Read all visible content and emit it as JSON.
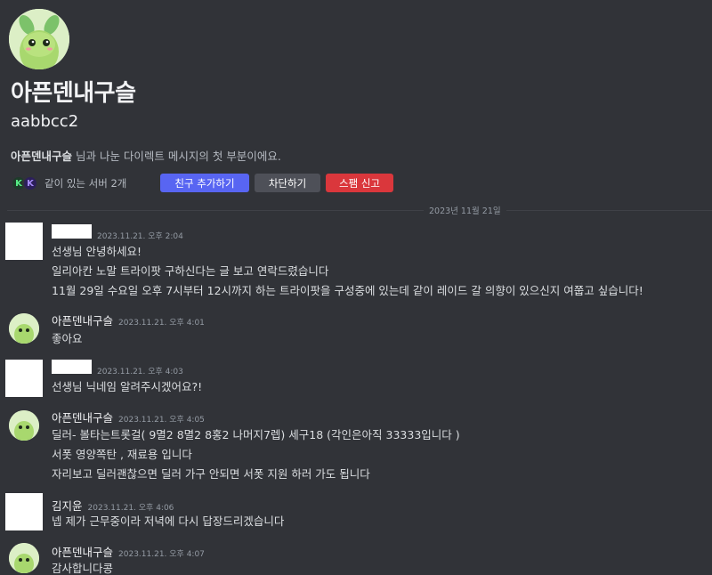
{
  "profile": {
    "display_name": "아픈덴내구슬",
    "username": "aabbcc2",
    "intro_name": "아픈덴내구슬",
    "intro_rest": " 님과 나눈 다이렉트 메시지의 첫 부분이에요.",
    "mutual_servers": "같이 있는 서버 2개"
  },
  "actions": {
    "add_friend": "친구 추가하기",
    "block": "차단하기",
    "report_spam": "스팸 신고"
  },
  "divider": {
    "date": "2023년 11월 21일"
  },
  "messages": [
    {
      "author": "",
      "time": "2023.11.21. 오후 2:04",
      "lines": [
        "선생님 안녕하세요!",
        "일리아칸 노말 트라이팟 구하신다는 글 보고 연락드렸습니다",
        "11월 29일 수요일 오후 7시부터 12시까지 하는 트라이팟을 구성중에 있는데 같이 레이드 갈 의향이 있으신지 여쭙고 싶습니다!"
      ]
    },
    {
      "author": "아픈덴내구슬",
      "time": "2023.11.21. 오후 4:01",
      "lines": [
        "좋아요"
      ]
    },
    {
      "author": "",
      "time": "2023.11.21. 오후 4:03",
      "lines": [
        "선생님 닉네임 알려주시겠어요?!"
      ]
    },
    {
      "author": "아픈덴내구슬",
      "time": "2023.11.21. 오후 4:05",
      "lines": [
        "딜러- 볼타는트롯걸( 9멸2 8멸2 8홍2 나머지7렙) 세구18 (각인은아직 33333입니다 )",
        "서폿  영양쪽탄 , 재료용 입니다",
        "자리보고 딜러괜찮으면 딜러 가구 안되면 서폿 지원 하러 가도 됩니다"
      ]
    },
    {
      "author": "김지윤",
      "time": "2023.11.21. 오후 4:06",
      "lines": [
        "넵 제가 근무중이라 저녁에 다시 답장드리겠습니다"
      ]
    },
    {
      "author": "아픈덴내구슬",
      "time": "2023.11.21. 오후 4:07",
      "lines": [
        "감사합니다콩"
      ]
    }
  ]
}
